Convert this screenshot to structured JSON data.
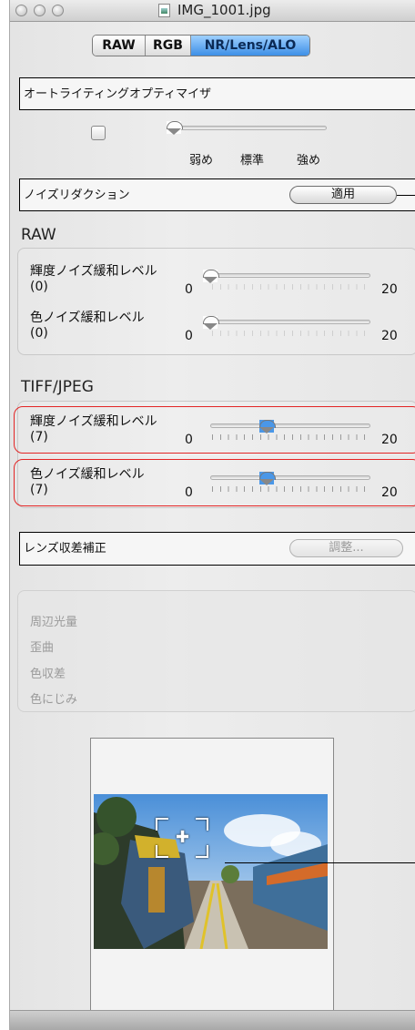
{
  "window": {
    "title": "IMG_1001.jpg"
  },
  "tabs": [
    {
      "label": "RAW",
      "active": false
    },
    {
      "label": "RGB",
      "active": false
    },
    {
      "label": "NR/Lens/ALO",
      "active": true
    }
  ],
  "alo": {
    "title": "オートライティングオプティマイザ",
    "checked": false,
    "levels": [
      "弱め",
      "標準",
      "強め"
    ],
    "level_index": 0
  },
  "nr": {
    "title": "ノイズリダクション",
    "apply_label": "適用"
  },
  "raw": {
    "label": "RAW",
    "rows": [
      {
        "name": "輝度ノイズ緩和レベル",
        "value_text": "(0)",
        "min": "0",
        "max": "20",
        "value": 0
      },
      {
        "name": "色ノイズ緩和レベル",
        "value_text": "(0)",
        "min": "0",
        "max": "20",
        "value": 0
      }
    ]
  },
  "tiff": {
    "label": "TIFF/JPEG",
    "rows": [
      {
        "name": "輝度ノイズ緩和レベル",
        "value_text": "(7)",
        "min": "0",
        "max": "20",
        "value": 7
      },
      {
        "name": "色ノイズ緩和レベル",
        "value_text": "(7)",
        "min": "0",
        "max": "20",
        "value": 7
      }
    ]
  },
  "lens": {
    "title": "レンズ収差補正",
    "adjust_label": "調整...",
    "items": [
      "周辺光量",
      "歪曲",
      "色収差",
      "色にじみ"
    ]
  },
  "colors": {
    "highlight": "#e32525",
    "tab_active": "#3d8fe6",
    "thumb": "#4a97e8"
  }
}
